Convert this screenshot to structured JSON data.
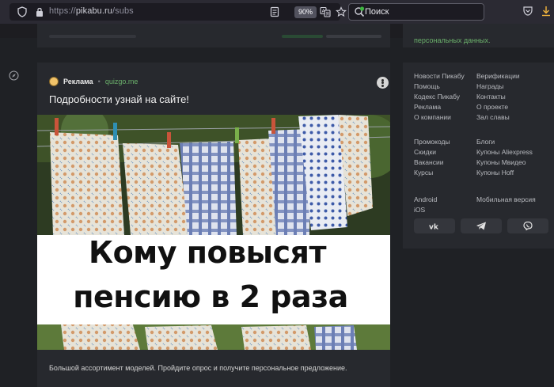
{
  "browser": {
    "url_scheme": "https://",
    "url_host": "pikabu.ru",
    "url_path": "/subs",
    "zoom": "90%",
    "search_placeholder": "Поиск"
  },
  "top_right": {
    "privacy_text": "персональных данных."
  },
  "post": {
    "ad_label": "Реклама",
    "ad_separator": "•",
    "ad_source": "quizgo.me",
    "title": "Подробности узнай на сайте!",
    "banner_line1": "Кому повысят",
    "banner_line2": "пенсию в 2 раза",
    "caption": "Большой ассортимент моделей. Пройдите опрос и получите персональное предложение."
  },
  "footer": {
    "col1_group1": [
      "Новости Пикабу",
      "Помощь",
      "Кодекс Пикабу",
      "Реклама",
      "О компании"
    ],
    "col2_group1": [
      "Верификации",
      "Награды",
      "Контакты",
      "О проекте",
      "Зал славы"
    ],
    "col1_group2": [
      "Промокоды",
      "Скидки",
      "Вакансии",
      "Курсы"
    ],
    "col2_group2": [
      "Блоги",
      "Купоны Aliexpress",
      "Купоны Мвидео",
      "Купоны Hoff"
    ],
    "col1_group3": [
      "Android",
      "iOS"
    ],
    "col2_group3": [
      "Мобильная версия"
    ]
  },
  "social": [
    "vk-icon",
    "telegram-icon",
    "viber-icon"
  ],
  "colors": {
    "accent_green": "#6bb06b",
    "page_bg": "#1f2125",
    "card_bg": "#27292e",
    "toolbar_bg": "#2b2a33"
  }
}
